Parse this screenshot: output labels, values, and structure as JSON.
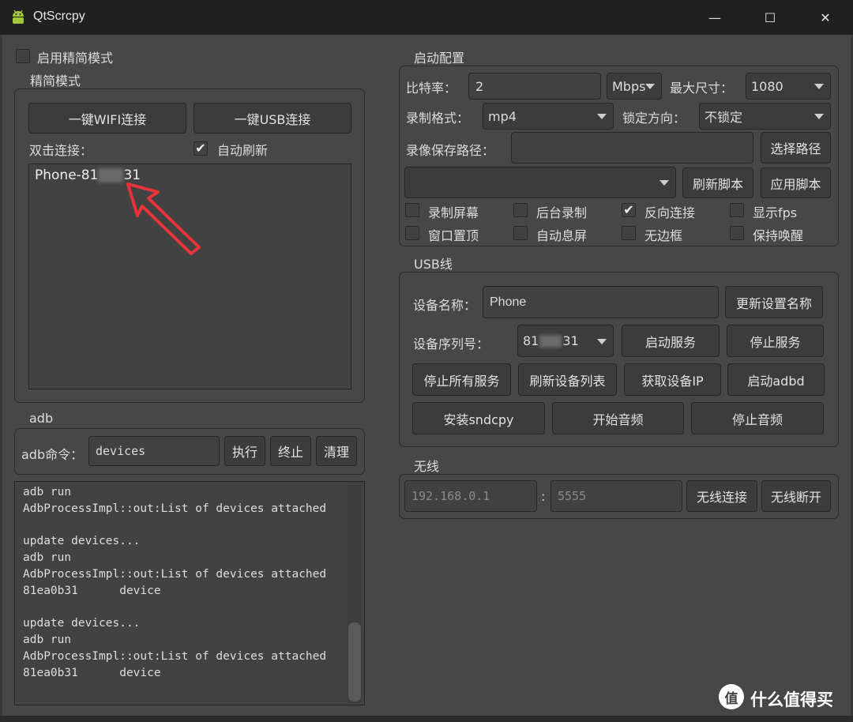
{
  "window": {
    "title": "QtScrcpy",
    "controls": {
      "minimize": "—",
      "maximize": "☐",
      "close": "✕"
    }
  },
  "simple_mode": {
    "toggle_label": "启用精简模式",
    "toggle_checked": false,
    "group_title": "精简模式",
    "wifi_connect_label": "一键WIFI连接",
    "usb_connect_label": "一键USB连接",
    "double_click_label": "双击连接：",
    "auto_refresh_label": "自动刷新",
    "auto_refresh_checked": true,
    "device_list": [
      {
        "prefix": "Phone-81",
        "suffix": "31"
      }
    ]
  },
  "adb": {
    "group_title": "adb",
    "command_label": "adb命令：",
    "command_value": "devices",
    "execute_label": "执行",
    "stop_label": "终止",
    "clear_label": "清理",
    "log_lines": [
      "adb run",
      "AdbProcessImpl::out:List of devices attached",
      "",
      "update devices...",
      "adb run",
      "AdbProcessImpl::out:List of devices attached",
      "81ea0b31      device",
      "",
      "update devices...",
      "adb run",
      "AdbProcessImpl::out:List of devices attached",
      "81ea0b31      device"
    ]
  },
  "start_config": {
    "group_title": "启动配置",
    "bitrate_label": "比特率：",
    "bitrate_value": "2",
    "bitrate_unit": "Mbps",
    "max_size_label": "最大尺寸：",
    "max_size_value": "1080",
    "record_format_label": "录制格式：",
    "record_format_value": "mp4",
    "lock_orientation_label": "锁定方向：",
    "lock_orientation_value": "不锁定",
    "record_path_label": "录像保存路径：",
    "record_path_value": "",
    "select_path_label": "选择路径",
    "script_value": "",
    "refresh_script_label": "刷新脚本",
    "apply_script_label": "应用脚本",
    "options": [
      {
        "label": "录制屏幕",
        "checked": false
      },
      {
        "label": "后台录制",
        "checked": false
      },
      {
        "label": "反向连接",
        "checked": true
      },
      {
        "label": "显示fps",
        "checked": false
      },
      {
        "label": "窗口置顶",
        "checked": false
      },
      {
        "label": "自动息屏",
        "checked": false
      },
      {
        "label": "无边框",
        "checked": false
      },
      {
        "label": "保持唤醒",
        "checked": false
      }
    ]
  },
  "usb": {
    "group_title": "USB线",
    "device_name_label": "设备名称：",
    "device_name_value": "Phone",
    "update_name_label": "更新设置名称",
    "serial_label": "设备序列号：",
    "serial_prefix": "81",
    "serial_suffix": "31",
    "start_service_label": "启动服务",
    "stop_service_label": "停止服务",
    "stop_all_label": "停止所有服务",
    "refresh_devices_label": "刷新设备列表",
    "get_ip_label": "获取设备IP",
    "start_adbd_label": "启动adbd",
    "install_sndcpy_label": "安装sndcpy",
    "start_audio_label": "开始音频",
    "stop_audio_label": "停止音频"
  },
  "wireless": {
    "group_title": "无线",
    "ip_placeholder": "192.168.0.1",
    "separator": ":",
    "port_placeholder": "5555",
    "connect_label": "无线连接",
    "disconnect_label": "无线断开"
  },
  "watermark": {
    "text": "什么值得买",
    "logo_glyph": "值"
  },
  "colors": {
    "background": "#474747",
    "titlebar": "#202020",
    "annotation_arrow": "#e8333a",
    "watermark_text": "#ffffff"
  }
}
